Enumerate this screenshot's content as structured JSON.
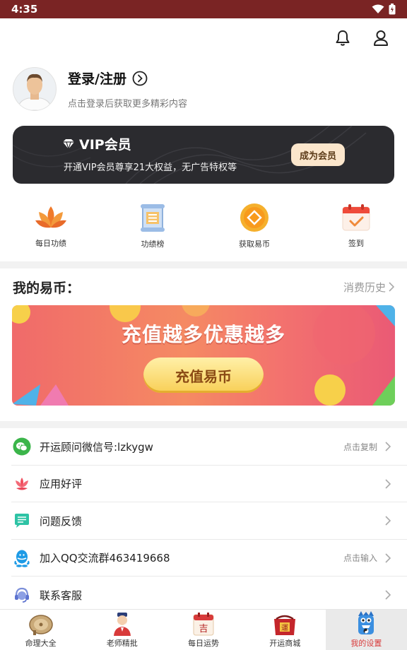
{
  "status": {
    "time": "4:35"
  },
  "profile": {
    "login_label": "登录/注册",
    "sub_label": "点击登录后获取更多精彩内容"
  },
  "vip": {
    "title": "VIP会员",
    "desc": "开通VIP会员尊享21大权益，无广告特权等",
    "button": "成为会员"
  },
  "quick": [
    {
      "label": "每日功绩",
      "icon": "lotus-icon"
    },
    {
      "label": "功绩榜",
      "icon": "scroll-list-icon"
    },
    {
      "label": "获取易币",
      "icon": "coin-icon"
    },
    {
      "label": "签到",
      "icon": "calendar-check-icon"
    }
  ],
  "coins": {
    "title": "我的易币：",
    "history": "消费历史"
  },
  "banner": {
    "title": "充值越多优惠越多",
    "button": "充值易币"
  },
  "list": [
    {
      "label": "开运顾问微信号:lzkygw",
      "hint": "点击复制",
      "icon": "wechat-icon"
    },
    {
      "label": "应用好评",
      "hint": "",
      "icon": "flower-icon"
    },
    {
      "label": "问题反馈",
      "hint": "",
      "icon": "message-icon"
    },
    {
      "label": "加入QQ交流群463419668",
      "hint": "点击输入",
      "icon": "qq-icon"
    },
    {
      "label": "联系客服",
      "hint": "",
      "icon": "headset-icon"
    }
  ],
  "tabs": [
    {
      "label": "命理大全",
      "icon": "divination-plate-icon",
      "active": false
    },
    {
      "label": "老师精批",
      "icon": "master-icon",
      "active": false
    },
    {
      "label": "每日运势",
      "icon": "daily-calendar-icon",
      "active": false
    },
    {
      "label": "开运商城",
      "icon": "lucky-bag-icon",
      "active": false
    },
    {
      "label": "我的设置",
      "icon": "mascot-icon",
      "active": true
    }
  ],
  "colors": {
    "status_bar": "#7a2424",
    "vip_card": "#2b2b2f",
    "vip_button": "#fbe6cc",
    "active_tab": "#d83a3a"
  }
}
